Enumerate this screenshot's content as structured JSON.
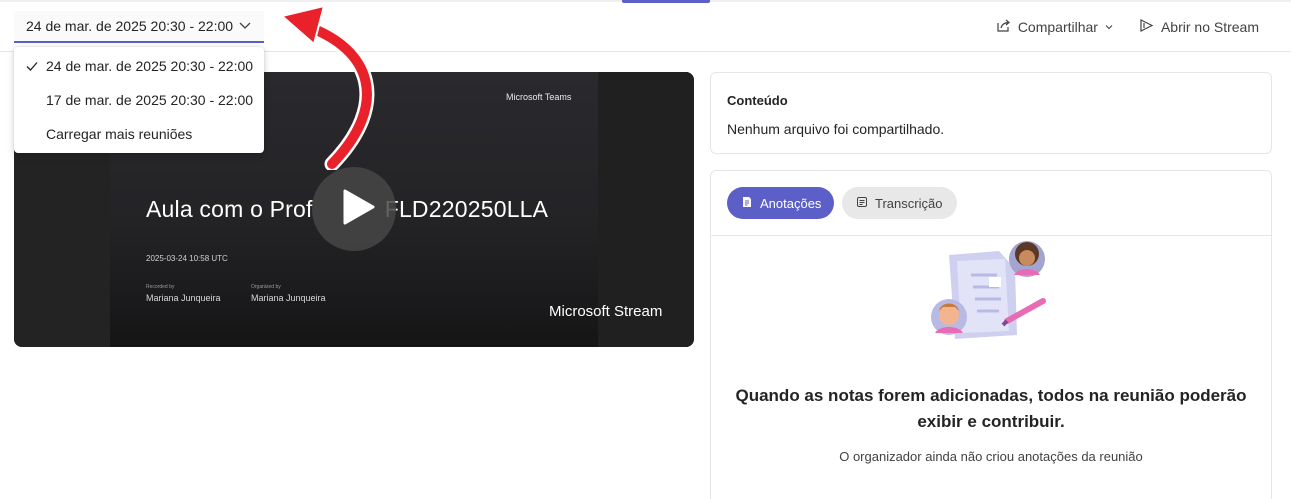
{
  "meeting_select": {
    "selected": "24 de mar. de 2025 20:30 - 22:00",
    "options": [
      {
        "label": "24 de mar. de 2025 20:30 - 22:00",
        "checked": true
      },
      {
        "label": "17 de mar. de 2025 20:30 - 22:00",
        "checked": false
      },
      {
        "label": "Carregar mais reuniões",
        "checked": false
      }
    ]
  },
  "header_actions": {
    "share_label": "Compartilhar",
    "open_stream_label": "Abrir no Stream"
  },
  "video": {
    "brand_top": "Microsoft Teams",
    "title": "Aula com o Prof               FLD220250LLA",
    "datetime": "2025-03-24 10:58 UTC",
    "meta": [
      {
        "key": "Recorded by",
        "value": "Mariana Junqueira"
      },
      {
        "key": "Organized by",
        "value": "Mariana Junqueira"
      }
    ],
    "brand_bottom": "Microsoft Stream"
  },
  "content_card": {
    "heading": "Conteúdo",
    "text": "Nenhum arquivo foi compartilhado."
  },
  "notes_card": {
    "tabs": [
      {
        "label": "Anotações",
        "active": true
      },
      {
        "label": "Transcrição",
        "active": false
      }
    ],
    "empty_title_line1": "Quando as notas forem adicionadas, todos na reunião poderão",
    "empty_title_line2": "exibir e contribuir.",
    "empty_subtitle": "O organizador ainda não criou anotações da reunião"
  },
  "colors": {
    "accent": "#5b5fc7",
    "annotation_arrow": "#e8212b"
  }
}
